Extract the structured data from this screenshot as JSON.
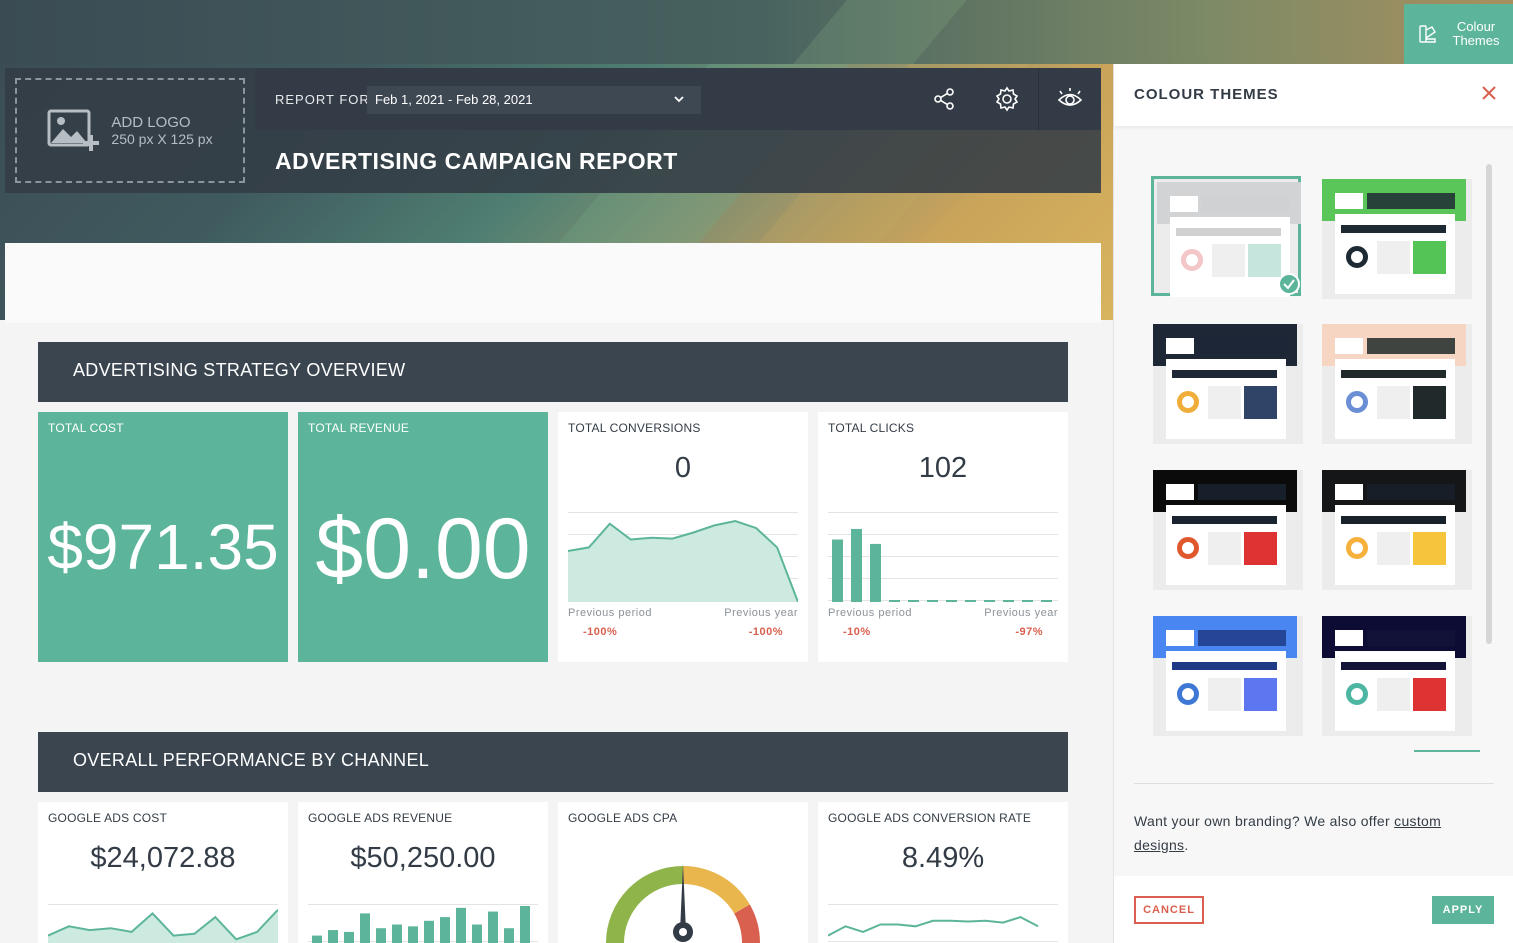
{
  "topbar": {
    "colour_themes_button": "Colour Themes"
  },
  "header": {
    "logo_line1": "ADD LOGO",
    "logo_line2": "250 px X 125 px",
    "report_for_label": "REPORT FOR",
    "date_range": "Feb 1, 2021 - Feb 28, 2021",
    "title": "ADVERTISING CAMPAIGN REPORT"
  },
  "sections": [
    {
      "title": "ADVERTISING STRATEGY OVERVIEW"
    },
    {
      "title": "OVERALL PERFORMANCE BY CHANNEL"
    }
  ],
  "overview_cards": [
    {
      "title": "TOTAL COST",
      "value": "$971.35"
    },
    {
      "title": "TOTAL REVENUE",
      "value": "$0.00"
    },
    {
      "title": "TOTAL CONVERSIONS",
      "value": "0",
      "prev_period_label": "Previous period",
      "prev_period_pct": "-100%",
      "prev_year_label": "Previous year",
      "prev_year_pct": "-100%"
    },
    {
      "title": "TOTAL CLICKS",
      "value": "102",
      "prev_period_label": "Previous period",
      "prev_period_pct": "-10%",
      "prev_year_label": "Previous year",
      "prev_year_pct": "-97%"
    }
  ],
  "channel_cards": [
    {
      "title": "GOOGLE ADS COST",
      "value": "$24,072.88"
    },
    {
      "title": "GOOGLE ADS REVENUE",
      "value": "$50,250.00"
    },
    {
      "title": "GOOGLE ADS CPA"
    },
    {
      "title": "GOOGLE ADS CONVERSION RATE",
      "value": "8.49%"
    }
  ],
  "chart_data": [
    {
      "type": "area",
      "chart": "total-conversions",
      "values": [
        0.58,
        0.62,
        0.89,
        0.71,
        0.73,
        0.72,
        0.79,
        0.87,
        0.92,
        0.84,
        0.62,
        0.0
      ]
    },
    {
      "type": "bar",
      "chart": "total-clicks",
      "values": [
        0.71,
        0.83,
        0.66,
        0.02,
        0.02,
        0.02,
        0.02,
        0.02,
        0.02,
        0.02,
        0.02,
        0.02
      ]
    },
    {
      "type": "area",
      "chart": "google-ads-cost",
      "values": [
        0.2,
        0.45,
        0.35,
        0.4,
        0.3,
        0.8,
        0.2,
        0.25,
        0.7,
        0.1,
        0.3,
        0.9
      ]
    },
    {
      "type": "bar",
      "chart": "google-ads-revenue",
      "values": [
        0.2,
        0.35,
        0.3,
        0.8,
        0.4,
        0.5,
        0.45,
        0.6,
        0.7,
        0.95,
        0.5,
        0.85,
        0.4,
        1.0
      ]
    },
    {
      "type": "line",
      "chart": "google-ads-conversion-rate",
      "values": [
        0.2,
        0.45,
        0.3,
        0.5,
        0.5,
        0.45,
        0.6,
        0.6,
        0.58,
        0.6,
        0.55,
        0.7,
        0.45
      ]
    }
  ],
  "panel": {
    "title": "COLOUR THEMES",
    "themes": [
      {
        "name": "default",
        "selected": true,
        "header": "#d2d3d4",
        "bar": "#cfd0d1",
        "accent": "#c6e6dd",
        "donut": "#f3c7c7"
      },
      {
        "name": "green",
        "selected": false,
        "header": "#5ac65a",
        "bar": "#1e2a33",
        "accent": "#55c456",
        "donut": "#1e2a33"
      },
      {
        "name": "navy",
        "selected": false,
        "header": "#1d2736",
        "bar": "#1d2736",
        "accent": "#2f4466",
        "donut": "#f0ad3a"
      },
      {
        "name": "peach",
        "selected": false,
        "header": "#f6d5c2",
        "bar": "#202a2a",
        "accent": "#202a2a",
        "donut": "#6a8fd4"
      },
      {
        "name": "black-red",
        "selected": false,
        "header": "#0b0b0c",
        "bar": "#1a2330",
        "accent": "#dd3333",
        "donut": "#e0582e"
      },
      {
        "name": "black-yellow",
        "selected": false,
        "header": "#141618",
        "bar": "#18202a",
        "accent": "#f6c53c",
        "donut": "#f6b03c"
      },
      {
        "name": "blue",
        "selected": false,
        "header": "#4a86f2",
        "bar": "#1f3b86",
        "accent": "#5c77ef",
        "donut": "#3e77d4"
      },
      {
        "name": "midnight",
        "selected": false,
        "header": "#0c0c35",
        "bar": "#141438",
        "accent": "#dd3333",
        "donut": "#4cb6a3"
      }
    ],
    "branding_text": "Want your own branding? We also offer ",
    "branding_link": "custom designs",
    "branding_end": ".",
    "cancel_label": "CANCEL",
    "apply_label": "APPLY"
  }
}
